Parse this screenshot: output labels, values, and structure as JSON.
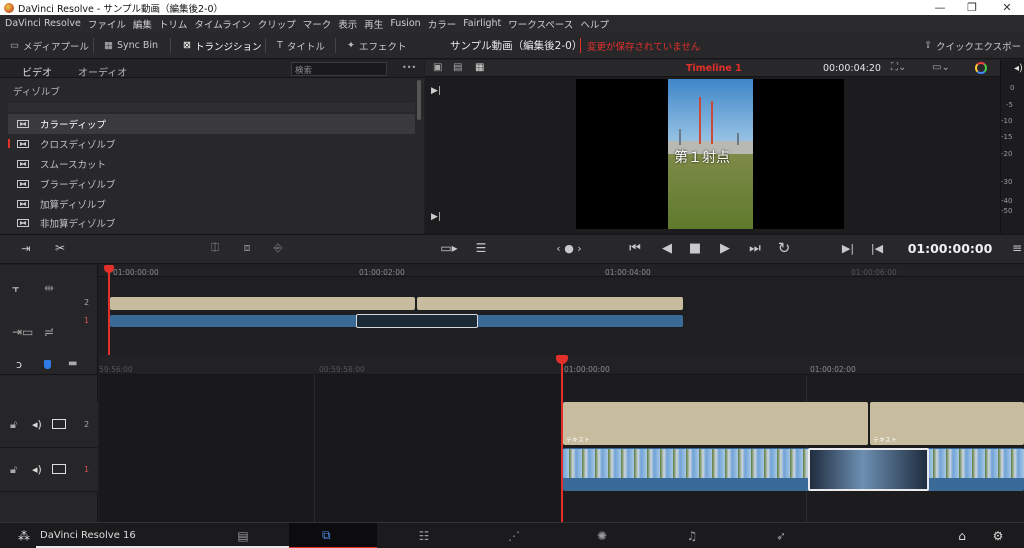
{
  "window": {
    "title": "DaVinci Resolve - サンプル動画（編集後2-0）",
    "minimize": "—",
    "maximize": "❐",
    "close": "✕"
  },
  "menu": [
    "DaVinci Resolve",
    "ファイル",
    "編集",
    "トリム",
    "タイムライン",
    "クリップ",
    "マーク",
    "表示",
    "再生",
    "Fusion",
    "カラー",
    "Fairlight",
    "ワークスペース",
    "ヘルプ"
  ],
  "toolbar": {
    "media_pool": "メディアプール",
    "sync_bin": "Sync Bin",
    "transitions": "トランジション",
    "titles": "タイトル",
    "effects": "エフェクト",
    "project_name": "サンプル動画（編集後2-0）",
    "unsaved": "変更が保存されていません",
    "quick_export": "クイックエクスポート"
  },
  "effects_panel": {
    "tab_video": "ビデオ",
    "tab_audio": "オーディオ",
    "search_placeholder": "検索",
    "more": "•••",
    "category": "ディゾルブ",
    "items": [
      "カラーディップ",
      "クロスディゾルブ",
      "スムースカット",
      "ブラーディゾルブ",
      "加算ディゾルブ",
      "非加算ディゾルブ"
    ]
  },
  "viewer": {
    "timeline_name": "Timeline 1",
    "duration": "00:00:04:20",
    "timecode": "01:00:00:00",
    "overlay_text": "第１射点",
    "nav": "‹ ● ›"
  },
  "mini_timeline": {
    "ruler": [
      "01:00:00:00",
      "01:00:02:00",
      "01:00:04:00",
      "01:00:06:00"
    ],
    "tracks": [
      "2",
      "1"
    ]
  },
  "main_timeline": {
    "ruler": [
      "59:56:00",
      "00:59:58:00",
      "01:00:00:00",
      "01:00:02:00"
    ],
    "tracks": [
      "2",
      "1"
    ],
    "clip_label": "テキスト"
  },
  "app": {
    "name": "DaVinci Resolve 16"
  },
  "colors": {
    "accent_red": "#e2302a",
    "video_clip": "#3a6a98",
    "title_clip": "#c7bc9e"
  }
}
